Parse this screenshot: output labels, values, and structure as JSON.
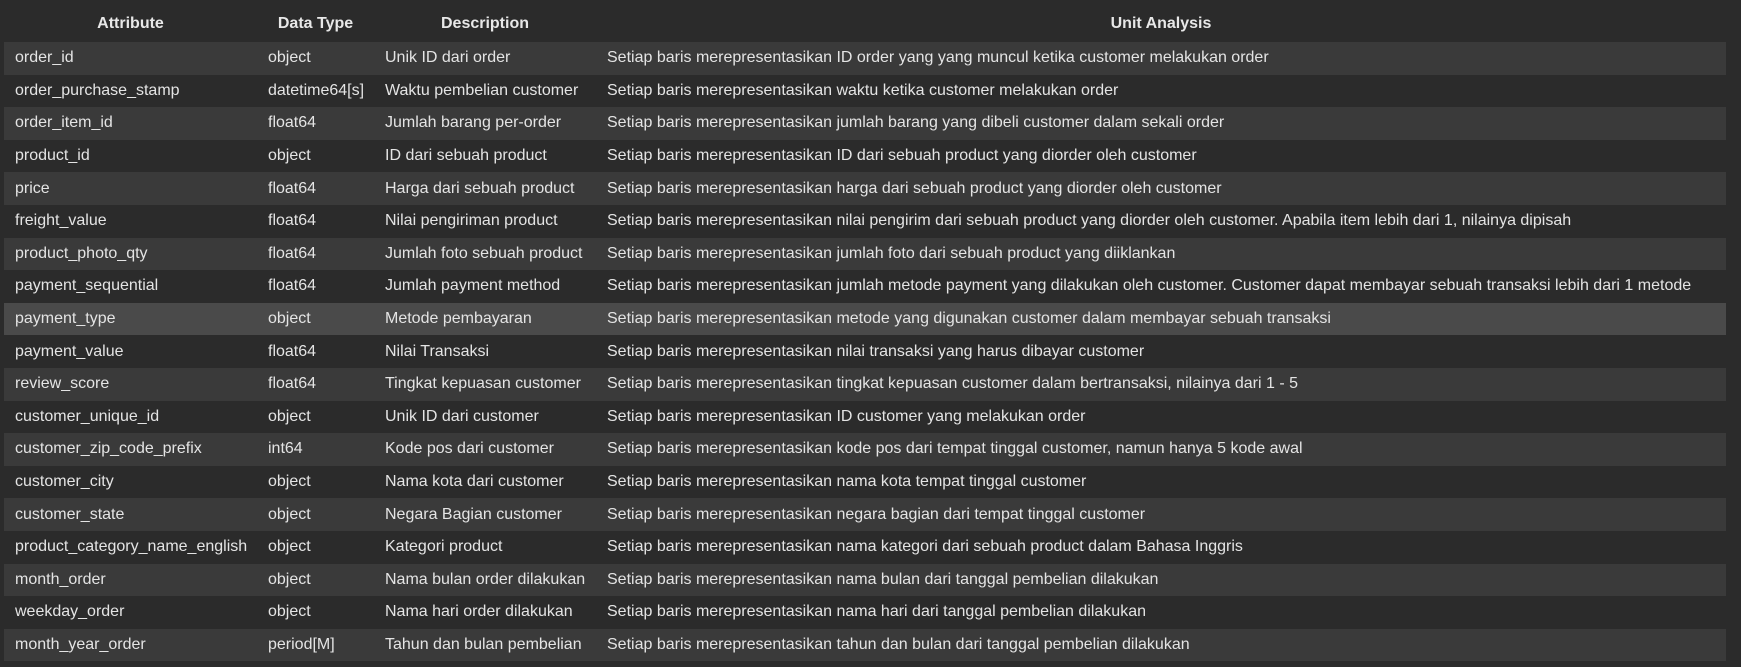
{
  "table": {
    "headers": [
      "Attribute",
      "Data Type",
      "Description",
      "Unit Analysis"
    ],
    "rows": [
      [
        "order_id",
        "object",
        "Unik ID dari order",
        "Setiap baris merepresentasikan ID order yang yang muncul ketika customer melakukan order"
      ],
      [
        "order_purchase_stamp",
        "datetime64[s]",
        "Waktu pembelian customer",
        "Setiap baris merepresentasikan waktu ketika customer melakukan order"
      ],
      [
        "order_item_id",
        "float64",
        "Jumlah barang per-order",
        "Setiap baris merepresentasikan jumlah barang yang dibeli customer dalam sekali order"
      ],
      [
        "product_id",
        "object",
        "ID dari sebuah product",
        "Setiap baris merepresentasikan ID dari sebuah product yang diorder oleh customer"
      ],
      [
        "price",
        "float64",
        "Harga dari sebuah product",
        "Setiap baris merepresentasikan harga dari sebuah product yang diorder oleh customer"
      ],
      [
        "freight_value",
        "float64",
        "Nilai pengiriman product",
        "Setiap baris merepresentasikan nilai pengirim dari sebuah product yang diorder oleh customer. Apabila item lebih dari 1, nilainya dipisah"
      ],
      [
        "product_photo_qty",
        "float64",
        "Jumlah foto sebuah product",
        "Setiap baris merepresentasikan jumlah foto dari sebuah product yang diiklankan"
      ],
      [
        "payment_sequential",
        "float64",
        "Jumlah payment method",
        "Setiap baris merepresentasikan jumlah metode payment yang dilakukan oleh customer. Customer dapat membayar sebuah transaksi lebih dari 1 metode"
      ],
      [
        "payment_type",
        "object",
        "Metode pembayaran",
        "Setiap baris merepresentasikan metode yang digunakan customer dalam membayar sebuah transaksi"
      ],
      [
        "payment_value",
        "float64",
        "Nilai Transaksi",
        "Setiap baris merepresentasikan nilai transaksi yang harus dibayar customer"
      ],
      [
        "review_score",
        "float64",
        "Tingkat kepuasan customer",
        "Setiap baris merepresentasikan tingkat kepuasan customer dalam bertransaksi, nilainya dari 1 - 5"
      ],
      [
        "customer_unique_id",
        "object",
        "Unik ID dari customer",
        "Setiap baris merepresentasikan ID customer yang melakukan order"
      ],
      [
        "customer_zip_code_prefix",
        "int64",
        "Kode pos dari customer",
        "Setiap baris merepresentasikan kode pos dari tempat tinggal customer, namun hanya 5 kode awal"
      ],
      [
        "customer_city",
        "object",
        "Nama kota dari customer",
        "Setiap baris merepresentasikan nama kota tempat tinggal customer"
      ],
      [
        "customer_state",
        "object",
        "Negara Bagian customer",
        "Setiap baris merepresentasikan negara bagian dari tempat tinggal customer"
      ],
      [
        "product_category_name_english",
        "object",
        "Kategori product",
        "Setiap baris merepresentasikan nama kategori dari sebuah product dalam Bahasa Inggris"
      ],
      [
        "month_order",
        "object",
        "Nama bulan order dilakukan",
        "Setiap baris merepresentasikan nama bulan dari tanggal pembelian dilakukan"
      ],
      [
        "weekday_order",
        "object",
        "Nama hari order dilakukan",
        "Setiap baris merepresentasikan nama hari dari tanggal pembelian dilakukan"
      ],
      [
        "month_year_order",
        "period[M]",
        "Tahun dan bulan pembelian",
        "Setiap baris merepresentasikan tahun dan bulan dari tanggal pembelian dilakukan"
      ]
    ]
  }
}
